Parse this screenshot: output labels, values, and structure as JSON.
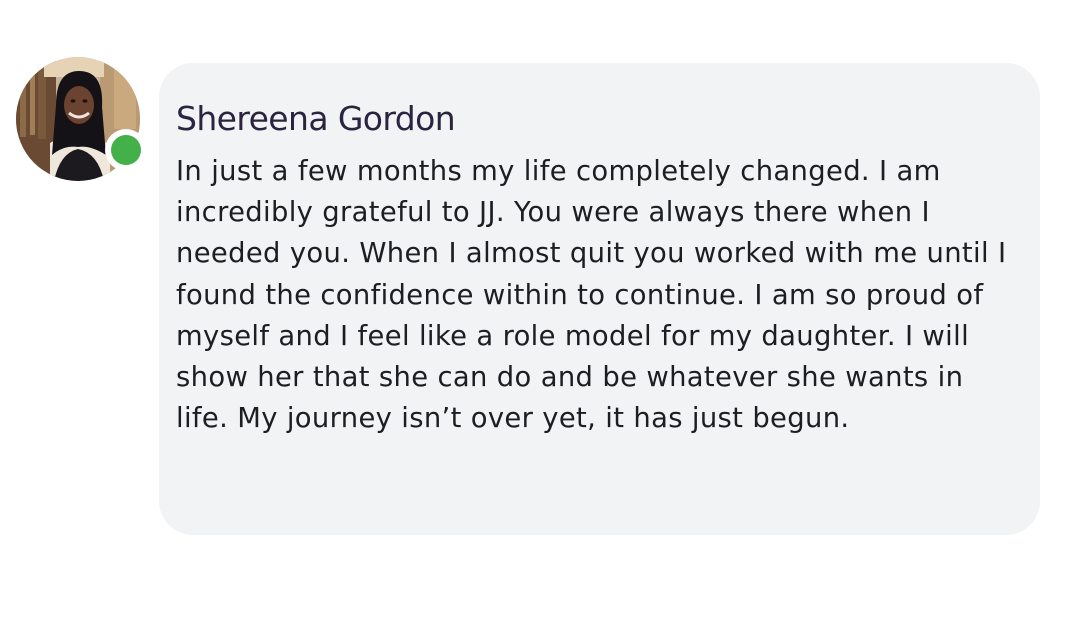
{
  "comment": {
    "author": {
      "name": "Shereena Gordon",
      "online": true
    },
    "text": "In just a few months my life completely changed. I am incredibly grateful to JJ. You were always there when I needed you. When I almost quit you worked with me until I found the confidence within to continue. I am so proud of myself and I feel like a role model for my daughter. I will show her that she can do and be whatever she wants in life. My journey isn’t over yet, it has just begun."
  },
  "colors": {
    "bubble_background": "#f2f3f5",
    "author_name": "#2b2440",
    "body_text": "#1c1e21",
    "online_indicator": "#44b049"
  },
  "icons": {
    "avatar": "profile-photo",
    "presence": "online-status-dot"
  }
}
